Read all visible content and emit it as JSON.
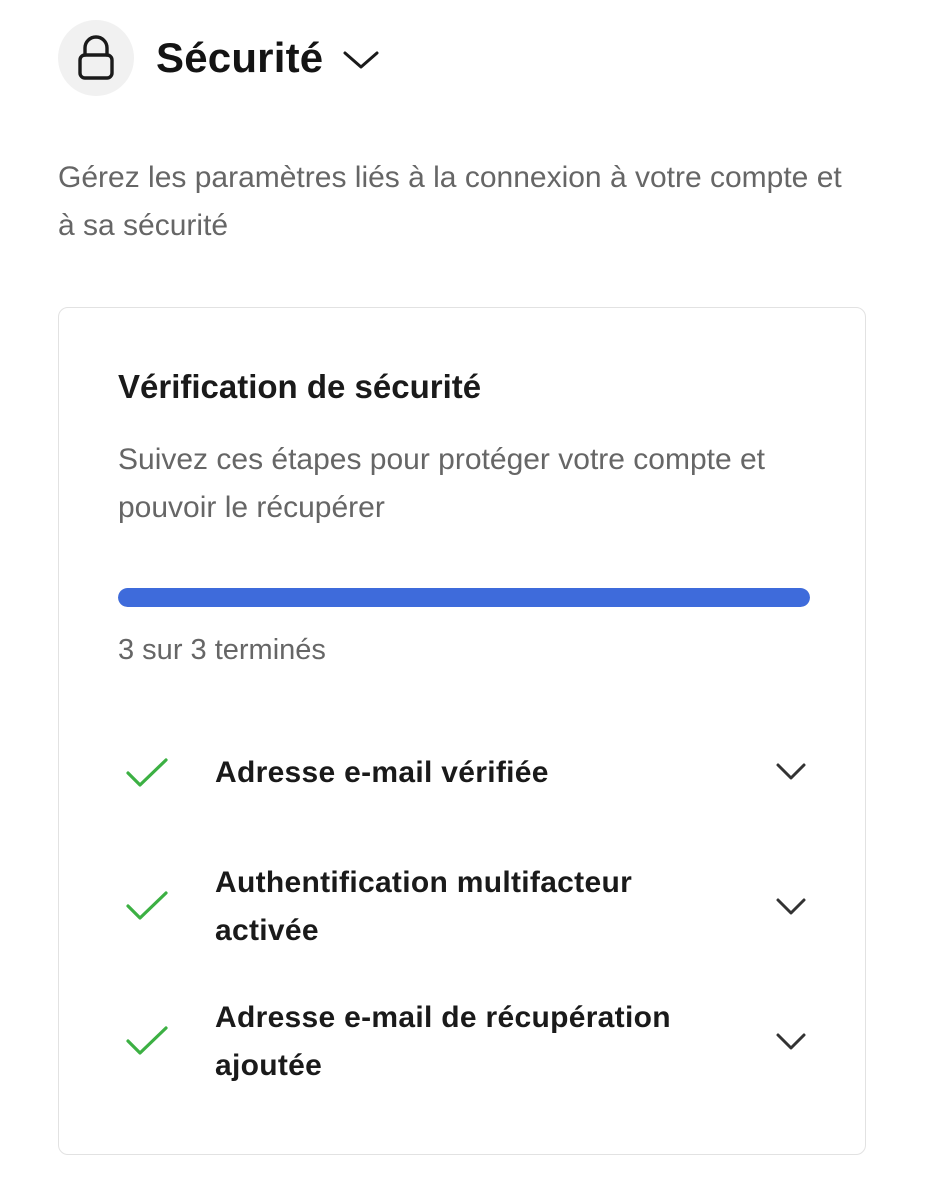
{
  "header": {
    "title": "Sécurité",
    "icon": "lock-icon",
    "dropdown_icon": "chevron-down-icon"
  },
  "intro": {
    "text": "Gérez les paramètres liés à la connexion à votre compte et à sa sécurité"
  },
  "card": {
    "title": "Vérification de sécurité",
    "description": "Suivez ces étapes pour protéger votre compte et pouvoir le récupérer",
    "progress": {
      "completed": 3,
      "total": 3,
      "fraction": 1.0,
      "label": "3 sur 3 terminés",
      "color": "#3e6bdb"
    },
    "items": [
      {
        "label": "Adresse e-mail vérifiée",
        "status": "done",
        "icon": "checkmark-icon"
      },
      {
        "label": "Authentification multifacteur activée",
        "status": "done",
        "icon": "checkmark-icon"
      },
      {
        "label": "Adresse e-mail de récupération ajoutée",
        "status": "done",
        "icon": "checkmark-icon"
      }
    ]
  },
  "colors": {
    "check_green": "#3cb043",
    "muted_text": "#666666",
    "accent_blue": "#3e6bdb"
  }
}
